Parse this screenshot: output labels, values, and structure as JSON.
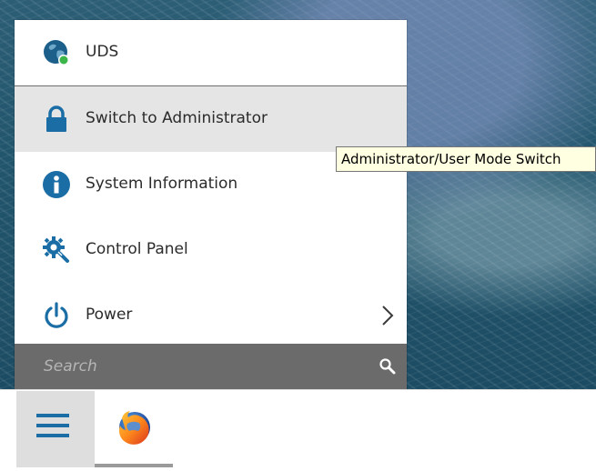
{
  "start_menu": {
    "items": [
      {
        "label": "UDS",
        "icon": "uds-globe-icon"
      },
      {
        "label": "Switch to Administrator",
        "icon": "lock-icon"
      },
      {
        "label": "System Information",
        "icon": "info-icon"
      },
      {
        "label": "Control Panel",
        "icon": "control-panel-icon"
      },
      {
        "label": "Power",
        "icon": "power-icon",
        "has_submenu": true
      }
    ],
    "hovered_item": "Switch to Administrator"
  },
  "search": {
    "placeholder": "Search",
    "value": ""
  },
  "tooltip": {
    "text": "Administrator/User Mode Switch"
  },
  "taskbar": {
    "items": [
      {
        "name": "menu",
        "icon": "hamburger-icon"
      },
      {
        "name": "firefox",
        "icon": "firefox-icon"
      }
    ]
  },
  "colors": {
    "accent": "#1a6ea5",
    "search_bg": "#6b6b6b",
    "tooltip_bg": "#ffffe1",
    "hover_bg": "#e5e5e5"
  }
}
